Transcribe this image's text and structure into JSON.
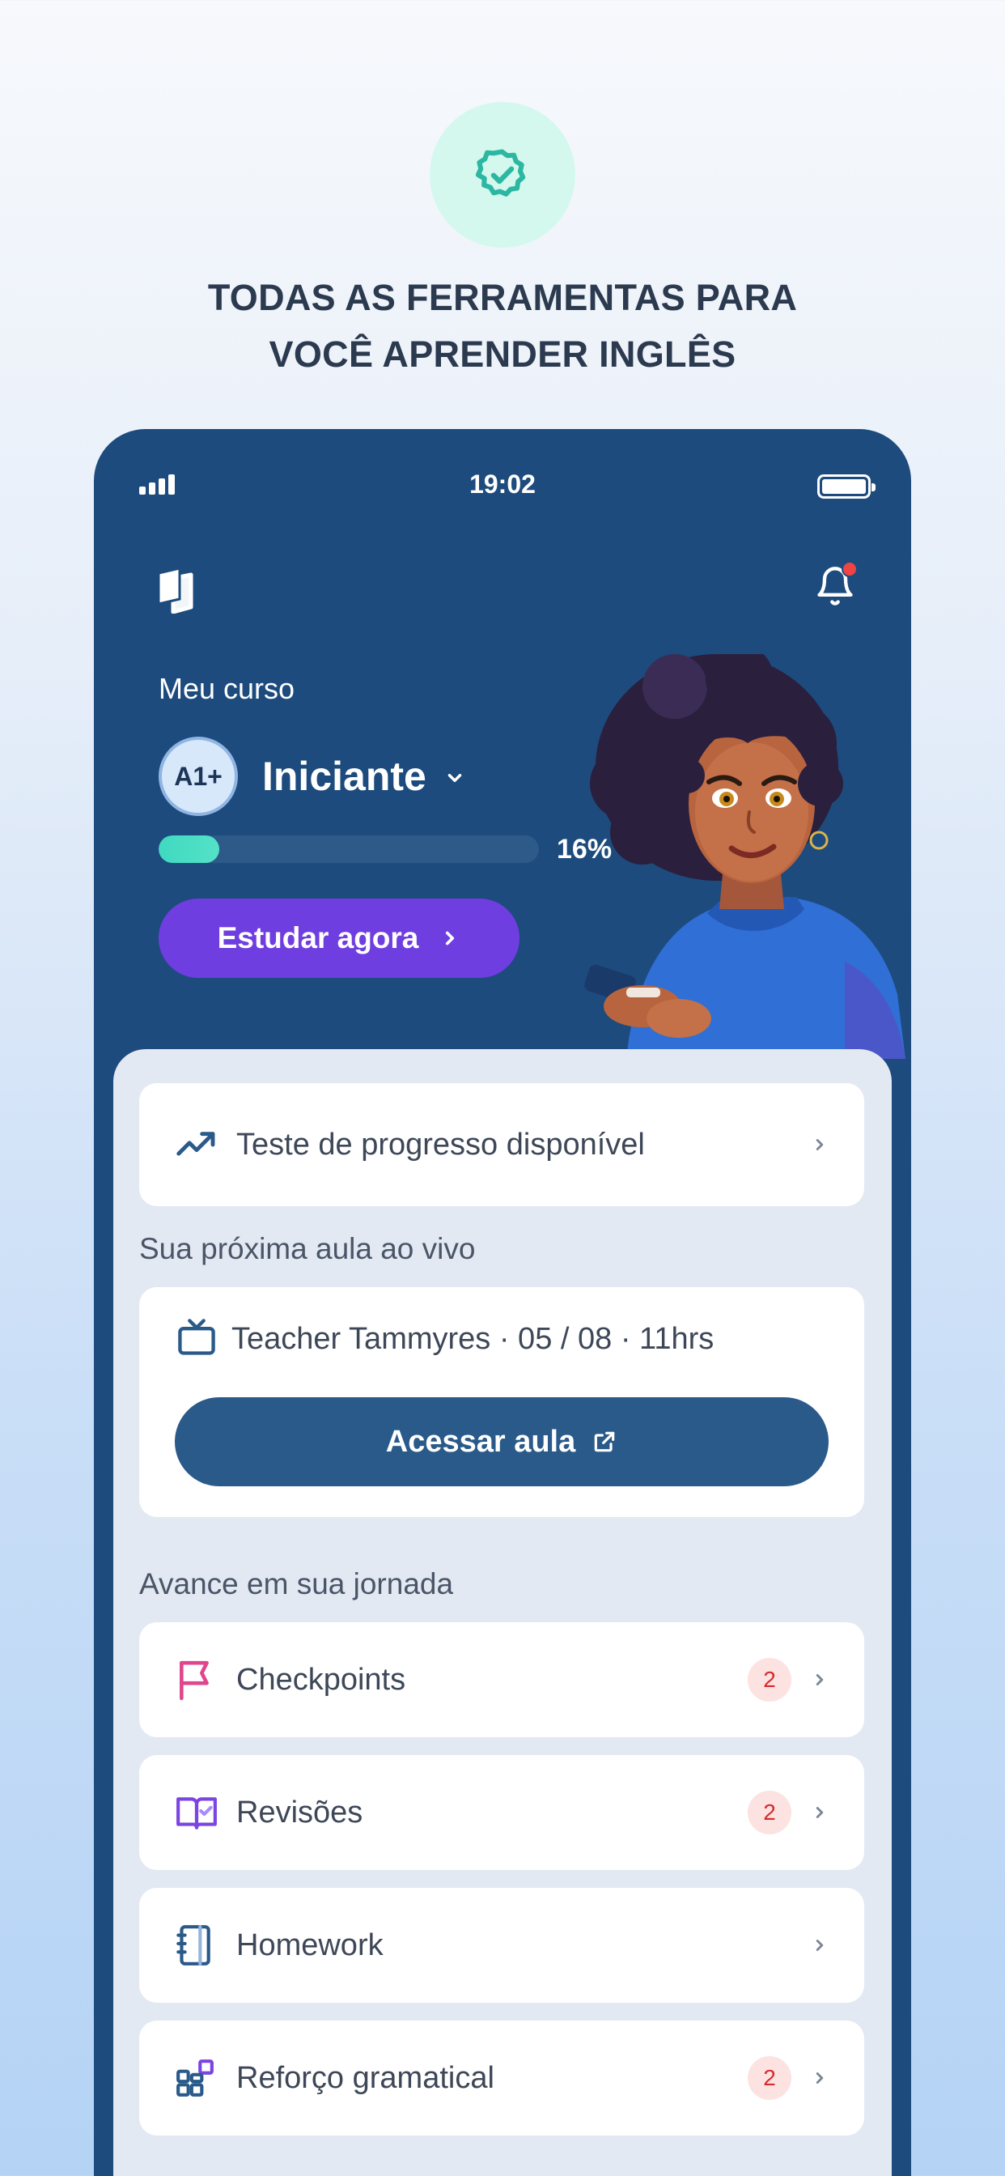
{
  "hero": {
    "icon": "verified-badge-icon",
    "headline_line1": "TODAS AS FERRAMENTAS PARA",
    "headline_line2": "VOCÊ APRENDER INGLÊS"
  },
  "status_bar": {
    "time": "19:02"
  },
  "course": {
    "label": "Meu curso",
    "level_badge": "A1+",
    "level_name": "Iniciante",
    "progress_percent": 16,
    "progress_text": "16%",
    "study_button": "Estudar agora"
  },
  "progress_test": {
    "label": "Teste de progresso disponível"
  },
  "live_class": {
    "section_title": "Sua próxima aula ao vivo",
    "info": "Teacher Tammyres · 05 / 08 · 11hrs",
    "button": "Acessar aula"
  },
  "journey": {
    "section_title": "Avance em sua jornada",
    "items": [
      {
        "label": "Checkpoints",
        "count": "2",
        "icon": "flag-icon"
      },
      {
        "label": "Revisões",
        "count": "2",
        "icon": "book-check-icon"
      },
      {
        "label": "Homework",
        "count": null,
        "icon": "notebook-icon"
      },
      {
        "label": "Reforço gramatical",
        "count": "2",
        "icon": "blocks-icon"
      }
    ]
  },
  "colors": {
    "phone_bg": "#1d4b7d",
    "accent_purple": "#6f3ee0",
    "progress_teal": "#3fd9c0",
    "button_blue": "#2a5a8a",
    "badge_red": "#d72a2a"
  }
}
